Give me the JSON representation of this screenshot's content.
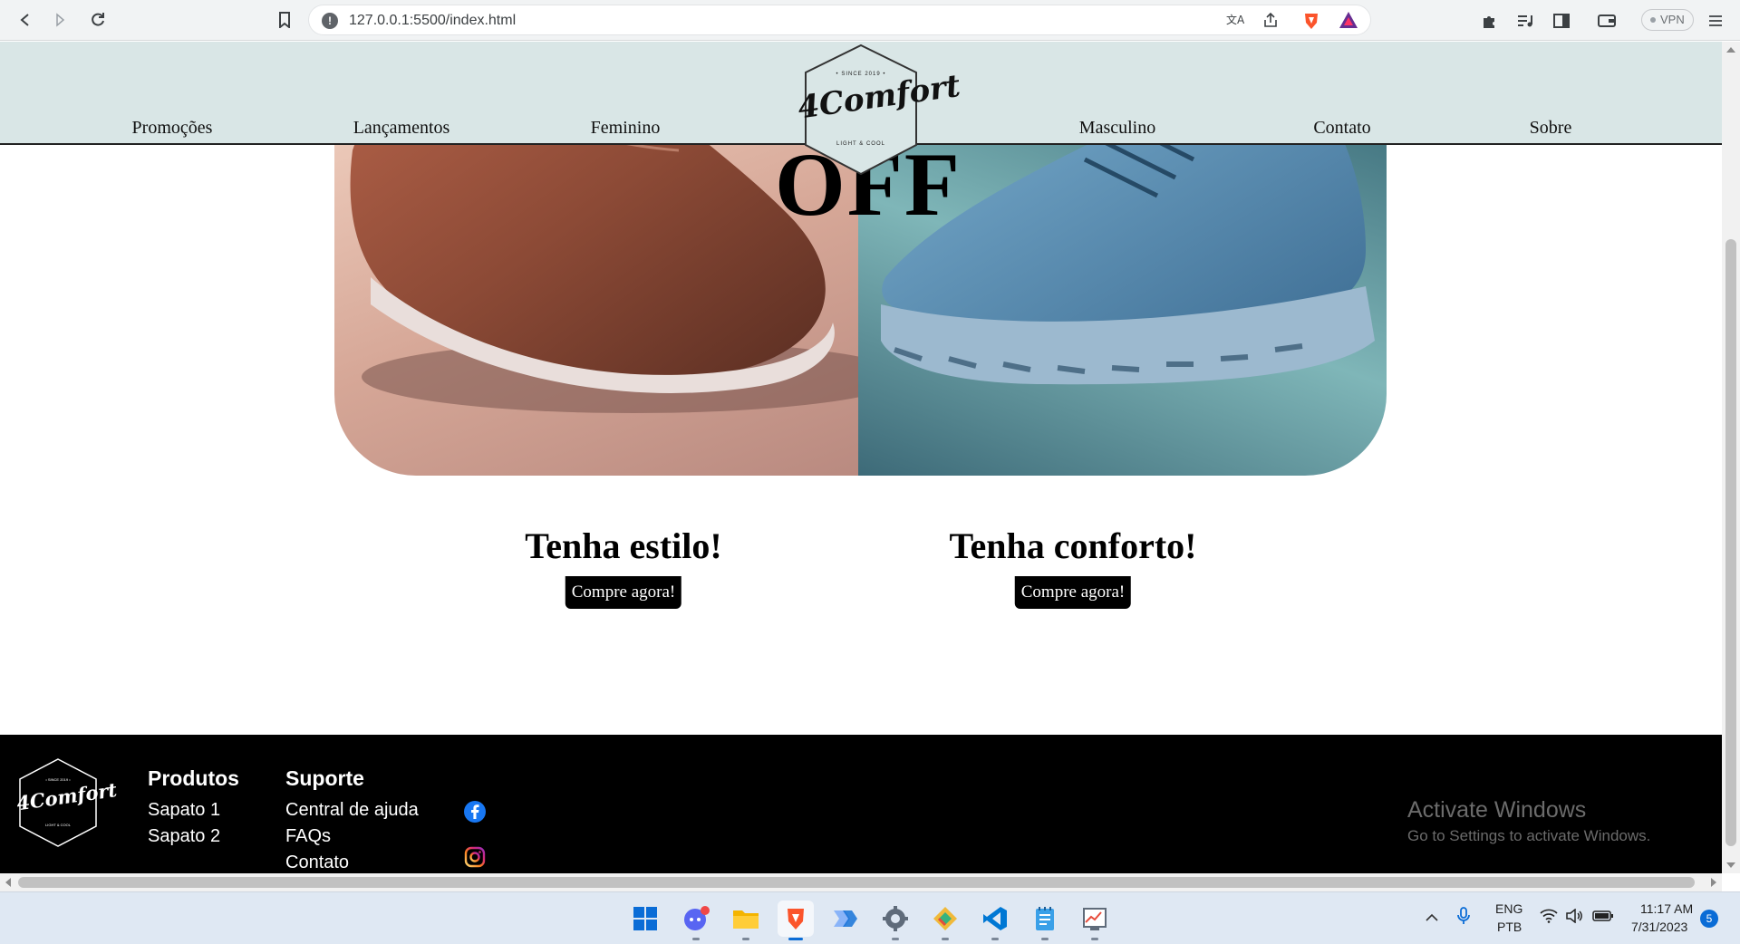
{
  "browser": {
    "url": "127.0.0.1:5500/index.html",
    "vpn_label": "VPN"
  },
  "site": {
    "brand": "4Comfort",
    "logo_since": "• SINCE 2019 •",
    "logo_tagline": "LIGHT & COOL",
    "nav": [
      "Promoções",
      "Lançamentos",
      "Feminino",
      "Masculino",
      "Contato",
      "Sobre"
    ],
    "hero_text": "OFF",
    "cards": [
      {
        "title": "Tenha estilo!",
        "button": "Compre agora!"
      },
      {
        "title": "Tenha conforto!",
        "button": "Compre agora!"
      }
    ],
    "footer": {
      "produtos_title": "Produtos",
      "produtos": [
        "Sapato 1",
        "Sapato 2"
      ],
      "suporte_title": "Suporte",
      "suporte": [
        "Central de ajuda",
        "FAQs",
        "Contato"
      ],
      "social_icons": [
        "facebook-icon",
        "instagram-icon"
      ]
    }
  },
  "watermark": {
    "line1": "Activate Windows",
    "line2": "Go to Settings to activate Windows."
  },
  "taskbar": {
    "lang1": "ENG",
    "lang2": "PTB",
    "time": "11:17 AM",
    "date": "7/31/2023",
    "notification_count": "5"
  },
  "colors": {
    "header_bg": "#d9e6e6",
    "footer_bg": "#000000",
    "button_bg": "#000000"
  }
}
